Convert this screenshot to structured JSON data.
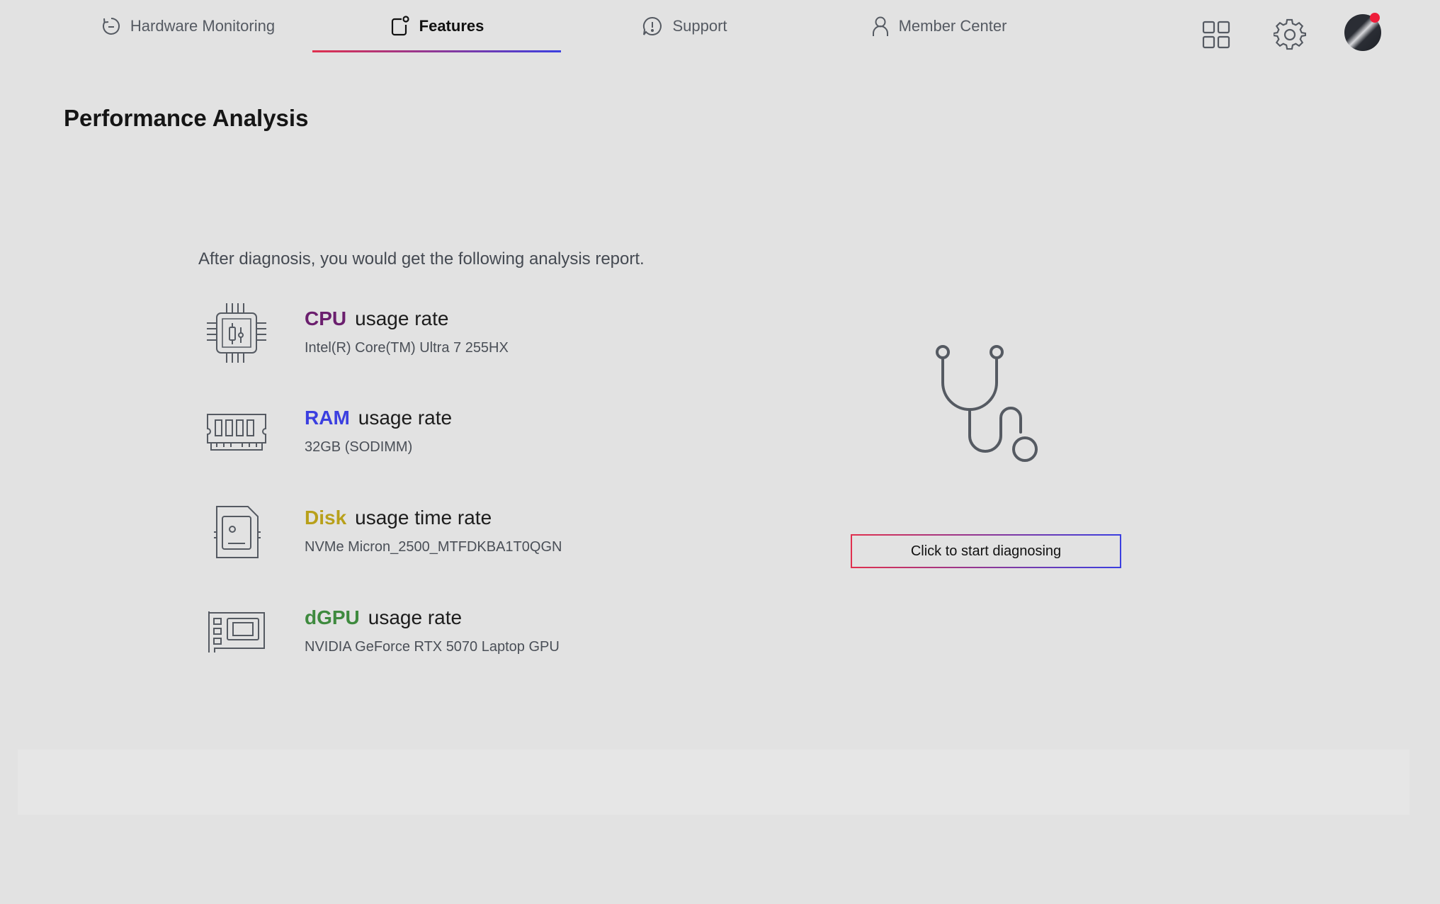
{
  "nav": {
    "tabs": [
      {
        "label": "Hardware Monitoring",
        "icon": "gauge-icon",
        "active": false
      },
      {
        "label": "Features",
        "icon": "features-icon",
        "active": true
      },
      {
        "label": "Support",
        "icon": "support-chat-icon",
        "active": false
      },
      {
        "label": "Member Center",
        "icon": "person-icon",
        "active": false
      }
    ],
    "right_icons": [
      "apps-grid-icon",
      "gear-icon",
      "avatar"
    ],
    "accent_gradient": [
      "#e0304e",
      "#3b3fe0"
    ],
    "notification_color": "#ee1d3a"
  },
  "page": {
    "title": "Performance Analysis",
    "intro": "After diagnosis, you would get the following analysis report."
  },
  "items": [
    {
      "name": "CPU",
      "metric": "usage rate",
      "detail": "Intel(R) Core(TM) Ultra 7 255HX",
      "color": "#6b1f6e",
      "icon": "cpu-chip-icon"
    },
    {
      "name": "RAM",
      "metric": "usage rate",
      "detail": "32GB (SODIMM)",
      "color": "#3b3fe0",
      "icon": "ram-module-icon"
    },
    {
      "name": "Disk",
      "metric": "usage time rate",
      "detail": "NVMe Micron_2500_MTFDKBA1T0QGN",
      "color": "#b8a01a",
      "icon": "disk-drive-icon"
    },
    {
      "name": "dGPU",
      "metric": "usage rate",
      "detail": "NVIDIA GeForce RTX 5070 Laptop GPU",
      "color": "#3e8a3e",
      "icon": "gpu-card-icon"
    }
  ],
  "diagnose": {
    "icon": "stethoscope-icon",
    "button_label": "Click to start diagnosing"
  }
}
